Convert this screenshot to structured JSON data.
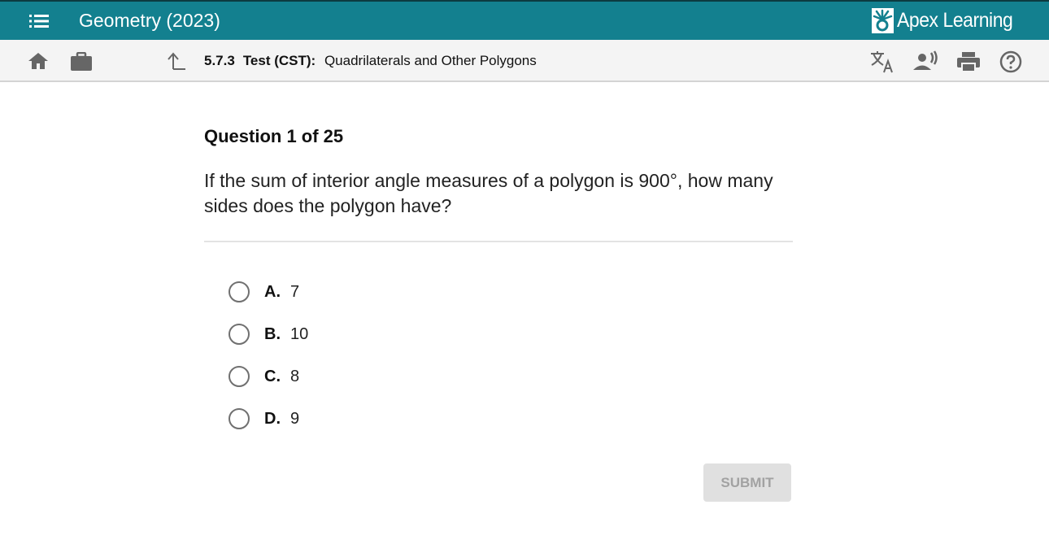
{
  "header": {
    "course_title": "Geometry (2023)",
    "brand_name": "Apex Learning",
    "menu_icon": "list-icon"
  },
  "subheader": {
    "lesson_number": "5.7.3",
    "lesson_type": "Test (CST):",
    "lesson_title": "Quadrilaterals and Other Polygons",
    "left_icons": [
      "home-icon",
      "briefcase-icon",
      "up-arrow-icon"
    ],
    "right_icons": [
      "translate-icon",
      "text-to-speech-icon",
      "print-icon",
      "help-icon"
    ]
  },
  "question": {
    "heading": "Question 1 of 25",
    "text": "If the sum of interior angle measures of a polygon is 900°, how many sides does the polygon have?",
    "options": [
      {
        "letter": "A.",
        "value": "7"
      },
      {
        "letter": "B.",
        "value": "10"
      },
      {
        "letter": "C.",
        "value": "8"
      },
      {
        "letter": "D.",
        "value": "9"
      }
    ],
    "submit_label": "SUBMIT"
  },
  "colors": {
    "header_bg": "#13808f",
    "subheader_bg": "#f4f4f4",
    "submit_disabled_bg": "#e0e0e0"
  }
}
